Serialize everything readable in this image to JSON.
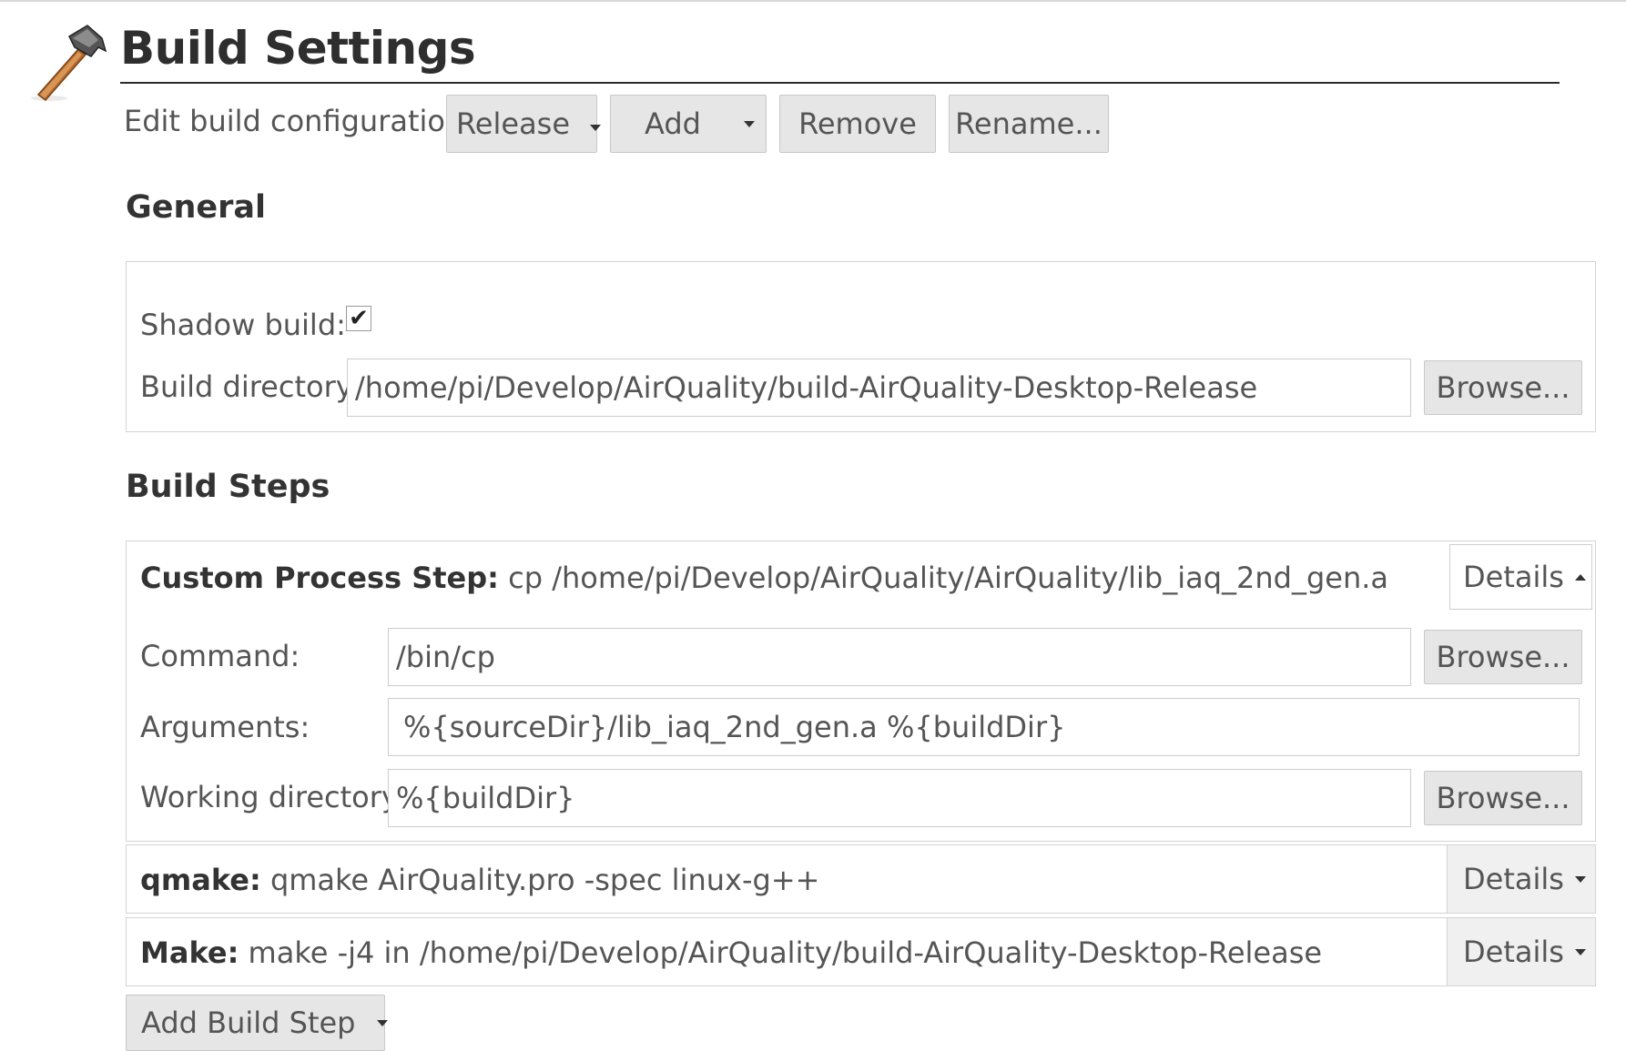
{
  "header": {
    "title": "Build Settings",
    "icon": "hammer-icon"
  },
  "config_bar": {
    "label": "Edit build configuration:",
    "selected": "Release",
    "add_label": "Add",
    "remove_label": "Remove",
    "rename_label": "Rename..."
  },
  "general": {
    "title": "General",
    "shadow_build_label": "Shadow build:",
    "shadow_build_checked": true,
    "check_mark": "✔",
    "build_dir_label": "Build directory:",
    "build_dir_value": "/home/pi/Develop/AirQuality/build-AirQuality-Desktop-Release",
    "browse_label": "Browse..."
  },
  "build_steps": {
    "title": "Build Steps",
    "steps": [
      {
        "name": "Custom Process Step:",
        "summary": "cp /home/pi/Develop/AirQuality/AirQuality/lib_iaq_2nd_gen.a",
        "details_label": "Details",
        "expanded": true
      },
      {
        "name": "qmake:",
        "summary": "qmake AirQuality.pro -spec linux-g++",
        "details_label": "Details",
        "expanded": false
      },
      {
        "name": "Make:",
        "summary": "make -j4 in /home/pi/Develop/AirQuality/build-AirQuality-Desktop-Release",
        "details_label": "Details",
        "expanded": false
      }
    ],
    "custom_step": {
      "command_label": "Command:",
      "command_value": "/bin/cp",
      "arguments_label": "Arguments:",
      "arguments_value": "%{sourceDir}/lib_iaq_2nd_gen.a %{buildDir}",
      "workdir_label": "Working directory:",
      "workdir_value": "%{buildDir}",
      "browse_label": "Browse..."
    },
    "add_step_label": "Add Build Step"
  }
}
